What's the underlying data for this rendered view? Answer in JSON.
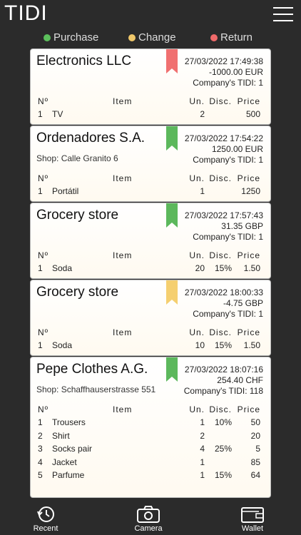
{
  "app": {
    "title": "TIDI"
  },
  "legend": [
    {
      "label": "Purchase",
      "color": "#5cc05c"
    },
    {
      "label": "Change",
      "color": "#f0c86a"
    },
    {
      "label": "Return",
      "color": "#f06a6a"
    }
  ],
  "table_headers": {
    "no": "Nº",
    "item": "Item",
    "un": "Un.",
    "disc": "Disc.",
    "price": "Price"
  },
  "receipts": [
    {
      "name": "Electronics LLC",
      "shop": "",
      "datetime": "27/03/2022 17:49:38",
      "amount": "-1000.00 EUR",
      "tidi": "Company's TIDI: 1",
      "type": "return",
      "ribbon_color": "#f07070",
      "items": [
        {
          "no": "1",
          "item": "TV",
          "un": "2",
          "disc": "",
          "price": "500"
        }
      ]
    },
    {
      "name": "Ordenadores S.A.",
      "shop": "Shop: Calle Granito 6",
      "datetime": "27/03/2022 17:54:22",
      "amount": "1250.00 EUR",
      "tidi": "Company's TIDI: 1",
      "type": "purchase",
      "ribbon_color": "#5cb85c",
      "items": [
        {
          "no": "1",
          "item": "Portátil",
          "un": "1",
          "disc": "",
          "price": "1250"
        }
      ]
    },
    {
      "name": "Grocery store",
      "shop": "",
      "datetime": "27/03/2022 17:57:43",
      "amount": "31.35 GBP",
      "tidi": "Company's TIDI: 1",
      "type": "purchase",
      "ribbon_color": "#5cb85c",
      "items": [
        {
          "no": "1",
          "item": "Soda",
          "un": "20",
          "disc": "15%",
          "price": "1.50"
        }
      ]
    },
    {
      "name": "Grocery store",
      "shop": "",
      "datetime": "27/03/2022 18:00:33",
      "amount": "-4.75 GBP",
      "tidi": "Company's TIDI: 1",
      "type": "change",
      "ribbon_color": "#f5cf70",
      "items": [
        {
          "no": "1",
          "item": "Soda",
          "un": "10",
          "disc": "15%",
          "price": "1.50"
        }
      ]
    },
    {
      "name": "Pepe Clothes A.G.",
      "shop": "Shop: Schaffhauserstrasse 551",
      "datetime": "27/03/2022 18:07:16",
      "amount": "254.40 CHF",
      "tidi": "Company's TIDI: 118",
      "type": "purchase",
      "ribbon_color": "#5cb85c",
      "items": [
        {
          "no": "1",
          "item": "Trousers",
          "un": "1",
          "disc": "10%",
          "price": "50"
        },
        {
          "no": "2",
          "item": "Shirt",
          "un": "2",
          "disc": "",
          "price": "20"
        },
        {
          "no": "3",
          "item": "Socks pair",
          "un": "4",
          "disc": "25%",
          "price": "5"
        },
        {
          "no": "4",
          "item": "Jacket",
          "un": "1",
          "disc": "",
          "price": "85"
        },
        {
          "no": "5",
          "item": "Parfume",
          "un": "1",
          "disc": "15%",
          "price": "64"
        }
      ]
    }
  ],
  "tabs": [
    {
      "label": "Recent",
      "icon": "recent-icon"
    },
    {
      "label": "Camera",
      "icon": "camera-icon"
    },
    {
      "label": "Wallet",
      "icon": "wallet-icon"
    }
  ]
}
